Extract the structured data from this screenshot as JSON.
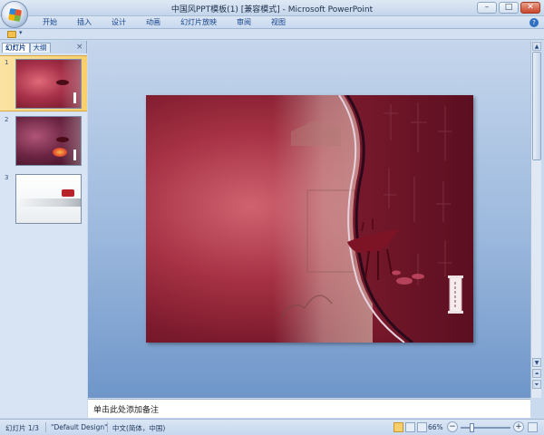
{
  "window": {
    "title": "中国风PPT模板(1) [兼容模式] - Microsoft PowerPoint",
    "controls": {
      "minimize": "–",
      "maximize": "□",
      "close": "✕"
    }
  },
  "ribbon": {
    "tabs": [
      "开始",
      "插入",
      "设计",
      "动画",
      "幻灯片放映",
      "审阅",
      "视图"
    ],
    "help": "?"
  },
  "quick_access": {
    "dropdown": "▾"
  },
  "left_panel": {
    "tabs": [
      "幻灯片",
      "大纲"
    ],
    "close": "×",
    "thumbnails": [
      {
        "number": "1",
        "selected": true
      },
      {
        "number": "2",
        "selected": false
      },
      {
        "number": "3",
        "selected": false
      }
    ]
  },
  "slide": {
    "scroll_label": "叶落作品"
  },
  "scrollbar": {
    "up": "▲",
    "down": "▼",
    "prev_slide": "⏶",
    "next_slide": "⏷"
  },
  "notes": {
    "placeholder": "单击此处添加备注"
  },
  "status": {
    "slide_counter": "幻灯片 1/3",
    "theme": "\"Default Design\"",
    "language": "中文(简体，中国)",
    "zoom": "66%",
    "zoom_minus": "−",
    "zoom_plus": "+"
  },
  "colors": {
    "slide_bg": "#a63244",
    "slide_dark": "#5f1021",
    "selection": "#f8cf6b",
    "ribbon_text": "#15428b"
  }
}
